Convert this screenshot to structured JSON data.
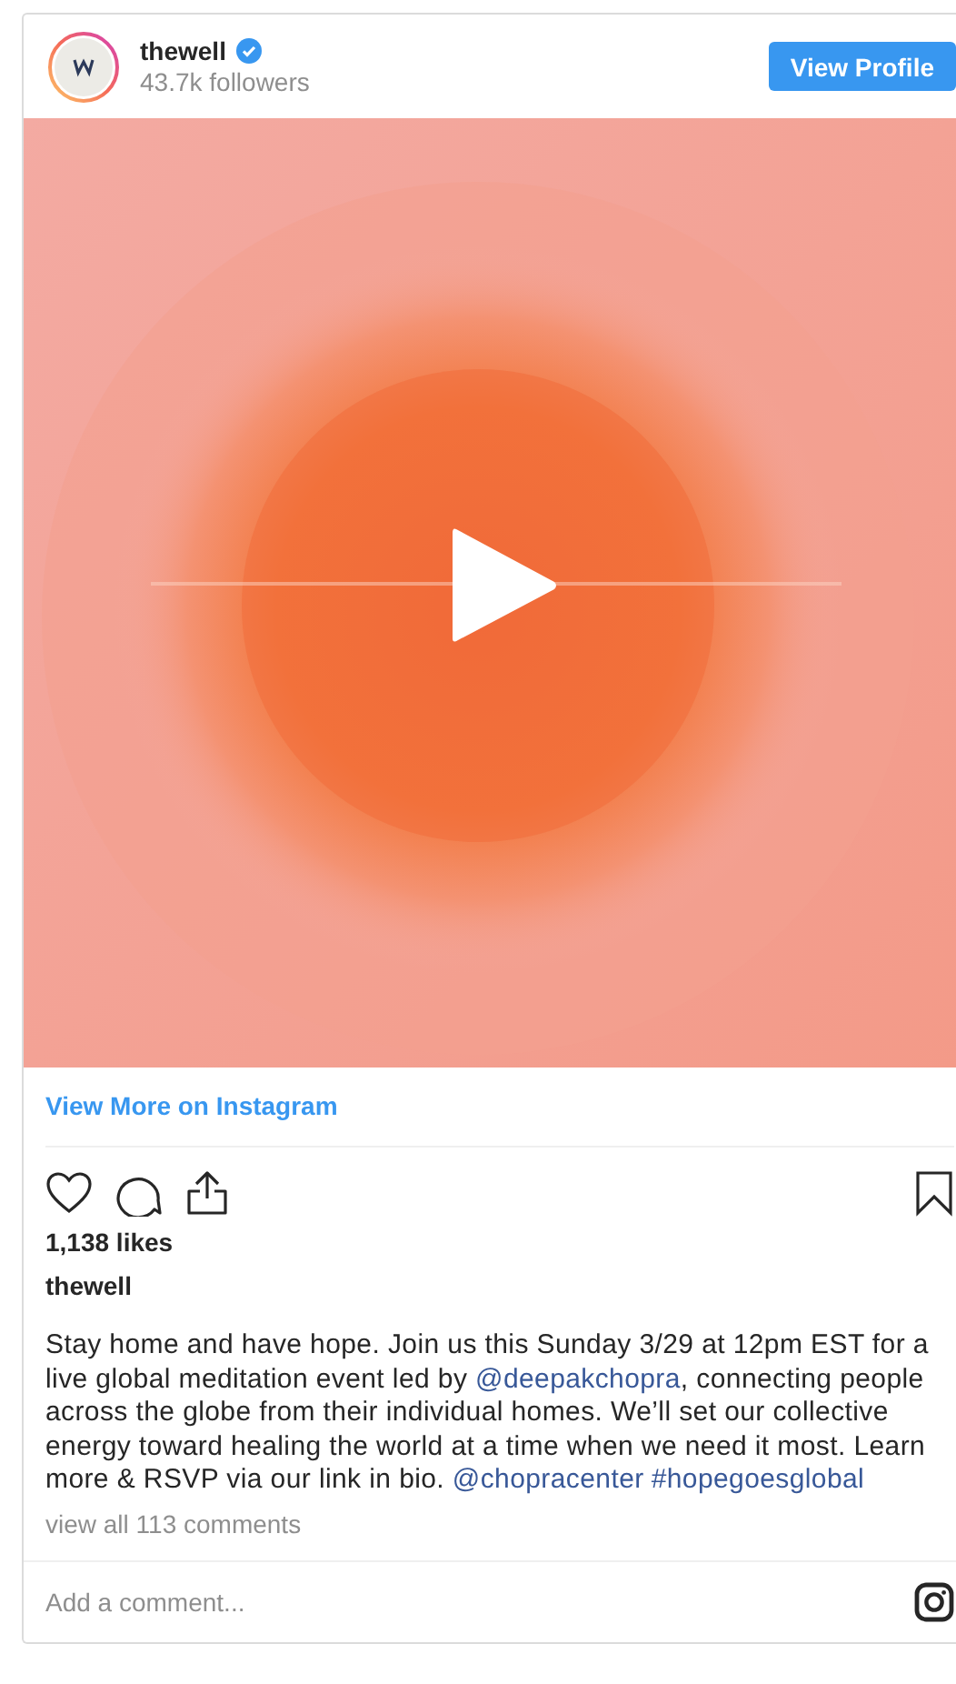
{
  "header": {
    "username": "thewell",
    "verified": true,
    "followers": "43.7k followers",
    "button": "View Profile"
  },
  "media": {
    "kind": "picture",
    "playable": true
  },
  "view_more": "View More on Instagram",
  "actions": {
    "liked": false,
    "saved": false
  },
  "likes": "1,138 likes",
  "author": "thewell",
  "caption": [
    {
      "kind": "text",
      "text": "Stay home and have hope. Join us this Sunday 3/29 at 12pm EST for a live global meditation event led by "
    },
    {
      "kind": "link",
      "text": "@deepakchopra"
    },
    {
      "kind": "text",
      "text": ", connecting people across the globe from their individual homes. We’ll set our collective energy toward healing the world at a time when we need it most. Learn more & RSVP via our link in bio. "
    },
    {
      "kind": "link",
      "text": "@chopracenter"
    },
    {
      "kind": "link",
      "text": "#hopegoesglobal"
    }
  ],
  "comments_link": "view all 113 comments",
  "comment_field": {
    "placeholder": "Add a comment..."
  }
}
